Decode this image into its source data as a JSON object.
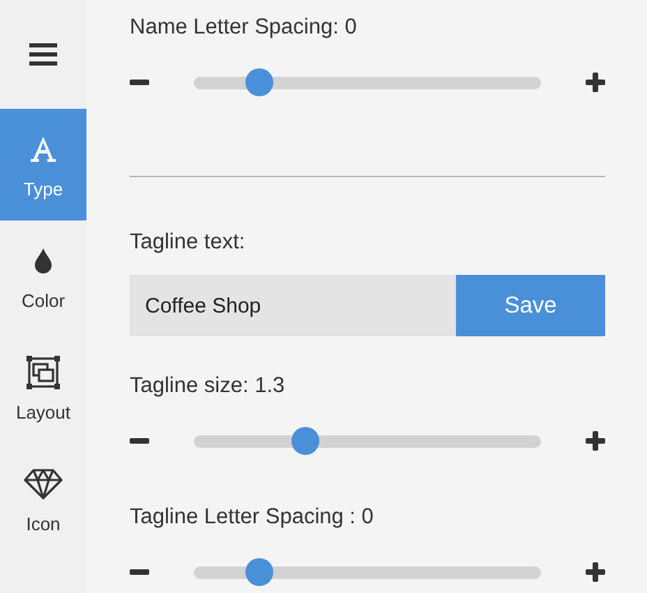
{
  "sidebar": {
    "tabs": [
      {
        "label": "Type",
        "selected": true
      },
      {
        "label": "Color",
        "selected": false
      },
      {
        "label": "Layout",
        "selected": false
      },
      {
        "label": "Icon",
        "selected": false
      }
    ]
  },
  "settings": [
    {
      "kind": "slider",
      "label": "Name Letter Spacing: 0",
      "level": 0.19
    },
    {
      "kind": "text",
      "label": "Tagline text:",
      "value": "Coffee Shop",
      "button": "Save"
    },
    {
      "kind": "slider",
      "label": "Tagline size: 1.3",
      "level": 0.32
    },
    {
      "kind": "slider",
      "label": "Tagline Letter Spacing : 0",
      "level": 0.19
    }
  ]
}
